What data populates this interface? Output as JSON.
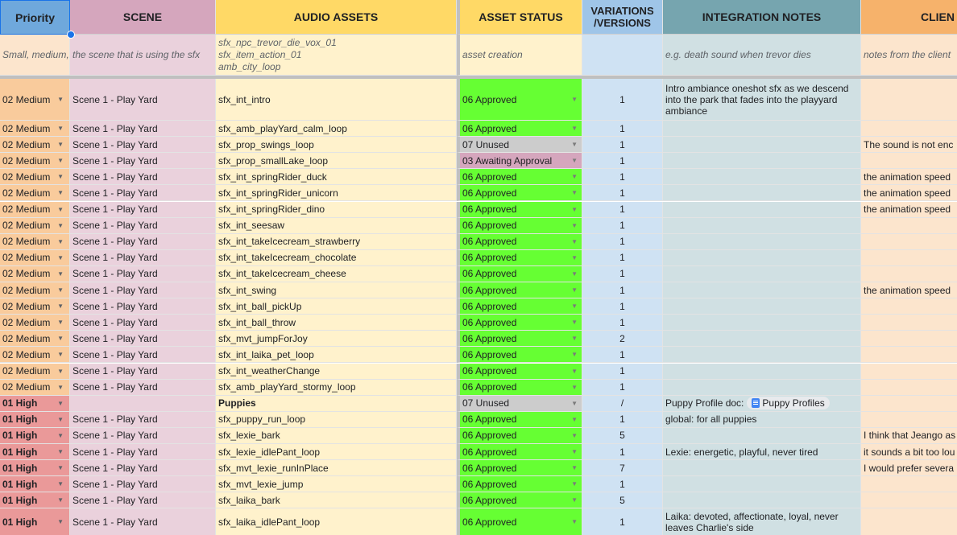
{
  "headers": {
    "priority": "Priority",
    "scene": "SCENE",
    "assets": "AUDIO ASSETS",
    "status": "ASSET STATUS",
    "variations": "VARIATIONS /VERSIONS",
    "notes": "INTEGRATION NOTES",
    "client": "CLIEN"
  },
  "example": {
    "priority": "Small, medium,",
    "scene": "the scene that is using the sfx",
    "assets_lines": [
      "sfx_npc_trevor_die_vox_01",
      "sfx_item_action_01",
      "amb_city_loop"
    ],
    "status": "asset creation",
    "variations": "",
    "notes": "e.g. death sound when trevor dies",
    "client": "notes from the client"
  },
  "colors": {
    "approved": "#66ff33",
    "unused": "#cccccc",
    "awaiting": "#d5a6bd",
    "medium": "#f9cb9c",
    "high": "#ea9999"
  },
  "rows": [
    {
      "priority": "02 Medium",
      "scene": "Scene 1 - Play Yard",
      "asset": "sfx_int_intro",
      "status": "06 Approved",
      "var": "1",
      "notes": "Intro ambiance oneshot sfx as we descend into the park that fades into the playyard ambiance",
      "client": ""
    },
    {
      "priority": "02 Medium",
      "scene": "Scene 1 - Play Yard",
      "asset": "sfx_amb_playYard_calm_loop",
      "status": "06 Approved",
      "var": "1",
      "notes": "",
      "client": ""
    },
    {
      "priority": "02 Medium",
      "scene": "Scene 1 - Play Yard",
      "asset": "sfx_prop_swings_loop",
      "status": "07 Unused",
      "var": "1",
      "notes": "",
      "client": "The sound is not enc"
    },
    {
      "priority": "02 Medium",
      "scene": "Scene 1 - Play Yard",
      "asset": "sfx_prop_smallLake_loop",
      "status": "03 Awaiting Approval",
      "var": "1",
      "notes": "",
      "client": ""
    },
    {
      "priority": "02 Medium",
      "scene": "Scene 1 - Play Yard",
      "asset": "sfx_int_springRider_duck",
      "status": "06 Approved",
      "var": "1",
      "notes": "",
      "client": "the animation speed"
    },
    {
      "priority": "02 Medium",
      "scene": "Scene 1 - Play Yard",
      "asset": "sfx_int_springRider_unicorn",
      "status": "06 Approved",
      "var": "1",
      "notes": "",
      "client": "the animation speed"
    },
    {
      "priority": "02 Medium",
      "scene": "Scene 1 - Play Yard",
      "asset": "sfx_int_springRider_dino",
      "status": "06 Approved",
      "var": "1",
      "notes": "",
      "client": "the animation speed"
    },
    {
      "priority": "02 Medium",
      "scene": "Scene 1 - Play Yard",
      "asset": "sfx_int_seesaw",
      "status": "06 Approved",
      "var": "1",
      "notes": "",
      "client": ""
    },
    {
      "priority": "02 Medium",
      "scene": "Scene 1 - Play Yard",
      "asset": "sfx_int_takeIcecream_strawberry",
      "status": "06 Approved",
      "var": "1",
      "notes": "",
      "client": ""
    },
    {
      "priority": "02 Medium",
      "scene": "Scene 1 - Play Yard",
      "asset": "sfx_int_takeIcecream_chocolate",
      "status": "06 Approved",
      "var": "1",
      "notes": "",
      "client": ""
    },
    {
      "priority": "02 Medium",
      "scene": "Scene 1 - Play Yard",
      "asset": "sfx_int_takeIcecream_cheese",
      "status": "06 Approved",
      "var": "1",
      "notes": "",
      "client": ""
    },
    {
      "priority": "02 Medium",
      "scene": "Scene 1 - Play Yard",
      "asset": "sfx_int_swing",
      "status": "06 Approved",
      "var": "1",
      "notes": "",
      "client": "the animation speed"
    },
    {
      "priority": "02 Medium",
      "scene": "Scene 1 - Play Yard",
      "asset": "sfx_int_ball_pickUp",
      "status": "06 Approved",
      "var": "1",
      "notes": "",
      "client": ""
    },
    {
      "priority": "02 Medium",
      "scene": "Scene 1 - Play Yard",
      "asset": "sfx_int_ball_throw",
      "status": "06 Approved",
      "var": "1",
      "notes": "",
      "client": ""
    },
    {
      "priority": "02 Medium",
      "scene": "Scene 1 - Play Yard",
      "asset": "sfx_mvt_jumpForJoy",
      "status": "06 Approved",
      "var": "2",
      "notes": "",
      "client": ""
    },
    {
      "priority": "02 Medium",
      "scene": "Scene 1 - Play Yard",
      "asset": "sfx_int_laika_pet_loop",
      "status": "06 Approved",
      "var": "1",
      "notes": "",
      "client": ""
    },
    {
      "priority": "02 Medium",
      "scene": "Scene 1 - Play Yard",
      "asset": "sfx_int_weatherChange",
      "status": "06 Approved",
      "var": "1",
      "notes": "",
      "client": ""
    },
    {
      "priority": "02 Medium",
      "scene": "Scene 1 - Play Yard",
      "asset": "sfx_amb_playYard_stormy_loop",
      "status": "06 Approved",
      "var": "1",
      "notes": "",
      "client": ""
    },
    {
      "priority": "01 High",
      "scene": "",
      "asset": "Puppies",
      "status": "07 Unused",
      "var": "/",
      "notes": "Puppy Profile doc:",
      "chip": "Puppy Profiles",
      "client": ""
    },
    {
      "priority": "01 High",
      "scene": "Scene 1 - Play Yard",
      "asset": "sfx_puppy_run_loop",
      "status": "06 Approved",
      "var": "1",
      "notes": "global: for all puppies",
      "client": ""
    },
    {
      "priority": "01 High",
      "scene": "Scene 1 - Play Yard",
      "asset": "sfx_lexie_bark",
      "status": "06 Approved",
      "var": "5",
      "notes": "",
      "client": "I think that Jeango as"
    },
    {
      "priority": "01 High",
      "scene": "Scene 1 - Play Yard",
      "asset": "sfx_lexie_idlePant_loop",
      "status": "06 Approved",
      "var": "1",
      "notes": "Lexie: energetic, playful, never tired",
      "client": "it sounds a bit too lou"
    },
    {
      "priority": "01 High",
      "scene": "Scene 1 - Play Yard",
      "asset": "sfx_mvt_lexie_runInPlace",
      "status": "06 Approved",
      "var": "7",
      "notes": "",
      "client": "I would prefer severa"
    },
    {
      "priority": "01 High",
      "scene": "Scene 1 - Play Yard",
      "asset": "sfx_mvt_lexie_jump",
      "status": "06 Approved",
      "var": "1",
      "notes": "",
      "client": ""
    },
    {
      "priority": "01 High",
      "scene": "Scene 1 - Play Yard",
      "asset": "sfx_laika_bark",
      "status": "06 Approved",
      "var": "5",
      "notes": "",
      "client": ""
    },
    {
      "priority": "01 High",
      "scene": "Scene 1 - Play Yard",
      "asset": "sfx_laika_idlePant_loop",
      "status": "06 Approved",
      "var": "1",
      "notes": "Laika: devoted, affectionate, loyal, never leaves Charlie's side",
      "client": ""
    }
  ]
}
